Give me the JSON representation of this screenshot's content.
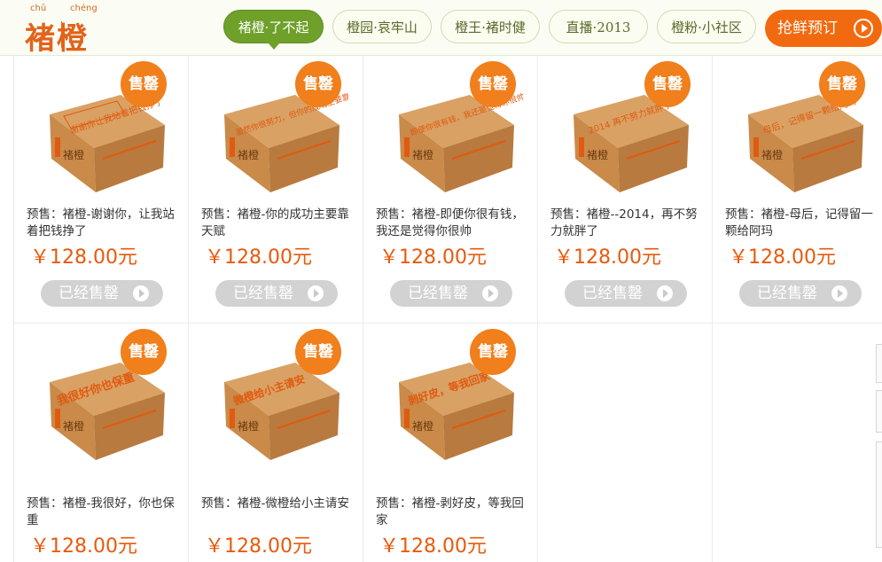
{
  "brand": {
    "pinyin1": "chǔ",
    "pinyin2": "chéng",
    "name": "褚橙"
  },
  "nav": [
    {
      "label": "褚橙·了不起",
      "active": true
    },
    {
      "label": "橙园·哀牢山",
      "active": false
    },
    {
      "label": "橙王·褚时健",
      "active": false
    },
    {
      "label": "直播·2013",
      "active": false
    },
    {
      "label": "橙粉·小社区",
      "active": false
    }
  ],
  "preorder_label": "抢鲜预订",
  "products": [
    {
      "title": "预售：褚橙-谢谢你，让我站着把钱挣了",
      "price": "￥128.00元",
      "badge": "售罄",
      "button": "已经售罄",
      "box_text": "谢谢你让我站着把钱挣了"
    },
    {
      "title": "预售：褚橙-你的成功主要靠天赋",
      "price": "￥128.00元",
      "badge": "售罄",
      "button": "已经售罄",
      "box_text": "虽然你很努力，但你的成功主要靠天赋"
    },
    {
      "title": "预售：褚橙-即便你很有钱，我还是觉得你很帅",
      "price": "￥128.00元",
      "badge": "售罄",
      "button": "已经售罄",
      "box_text": "即便你很有钱，我还是觉得你很帅"
    },
    {
      "title": "预售：褚橙--2014，再不努力就胖了",
      "price": "￥128.00元",
      "badge": "售罄",
      "button": "已经售罄",
      "box_text": "2014 再不努力就胖了"
    },
    {
      "title": "预售：褚橙-母后，记得留一颗给阿玛",
      "price": "￥128.00元",
      "badge": "售罄",
      "button": "已经售罄",
      "box_text": "母后，记得留一颗给阿玛"
    },
    {
      "title": "预售：褚橙-我很好，你也保重",
      "price": "￥128.00元",
      "badge": "售罄",
      "box_text": "我很好你也保重"
    },
    {
      "title": "预售：褚橙-微橙给小主请安",
      "price": "￥128.00元",
      "badge": "售罄",
      "box_text": "微橙给小主请安"
    },
    {
      "title": "预售：褚橙-剥好皮，等我回家",
      "price": "￥128.00元",
      "badge": "售罄",
      "box_text": "剥好皮，等我回家"
    }
  ],
  "box_brand": "褚橙",
  "colors": {
    "accent": "#f26a10",
    "nav_active": "#6ea02a",
    "price": "#e85a0c",
    "box": "#c98a4a"
  }
}
